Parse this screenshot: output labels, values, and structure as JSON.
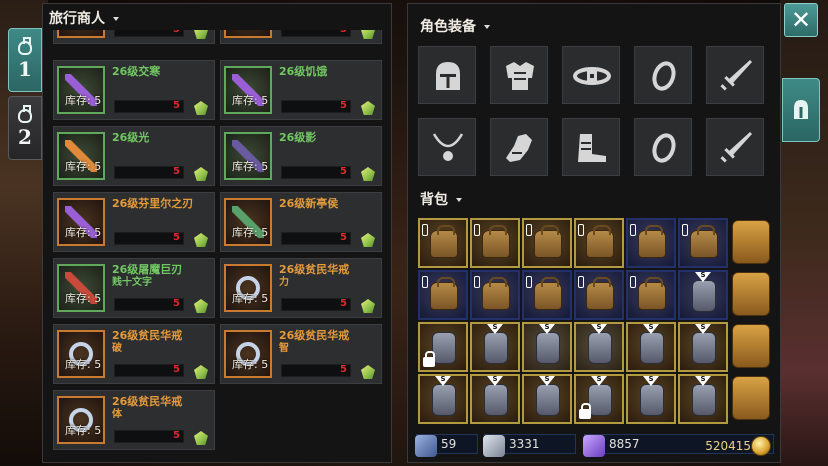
{
  "merchant": {
    "title": "旅行商人",
    "stock_prefix": "库存:",
    "items": [
      {
        "name": "",
        "stock": "5",
        "price": "5",
        "rarity": "orange",
        "partial": true
      },
      {
        "name": "",
        "stock": "5",
        "price": "5",
        "rarity": "orange",
        "partial": true
      },
      {
        "name": "26级交寒",
        "stock": "5",
        "price": "5",
        "rarity": "green",
        "icon": "purple-sword-icon"
      },
      {
        "name": "26级饥饿",
        "stock": "5",
        "price": "5",
        "rarity": "green",
        "icon": "purple-sword-icon"
      },
      {
        "name": "26级光",
        "stock": "5",
        "price": "5",
        "rarity": "green",
        "icon": "fire-dagger-icon"
      },
      {
        "name": "26级影",
        "stock": "5",
        "price": "5",
        "rarity": "green",
        "icon": "dark-mace-icon"
      },
      {
        "name": "26级芬里尔之刃",
        "stock": "5",
        "price": "5",
        "rarity": "orange",
        "icon": "purple-blade-icon"
      },
      {
        "name": "26级新亭侯",
        "stock": "5",
        "price": "5",
        "rarity": "orange",
        "icon": "green-blade-icon"
      },
      {
        "name": "26级屠魔巨刃",
        "subname": "贱十文字",
        "stock": "5",
        "price": "5",
        "rarity": "green",
        "icon": "red-greatsword-icon"
      },
      {
        "name": "26级贫民华戒",
        "subname": "力",
        "stock": "5",
        "price": "5",
        "rarity": "orange",
        "icon": "silver-ring-icon"
      },
      {
        "name": "26级贫民华戒",
        "subname": "破",
        "stock": "5",
        "price": "5",
        "rarity": "orange",
        "icon": "silver-ring-icon"
      },
      {
        "name": "26级贫民华戒",
        "subname": "智",
        "stock": "5",
        "price": "5",
        "rarity": "orange",
        "icon": "silver-ring-icon"
      },
      {
        "name": "26级贫民华戒",
        "subname": "体",
        "stock": "5",
        "price": "5",
        "rarity": "orange",
        "icon": "silver-ring-icon"
      }
    ]
  },
  "side_tabs": [
    {
      "label": "1",
      "active": true,
      "icon": "potion-icon"
    },
    {
      "label": "2",
      "active": false,
      "icon": "potion-icon"
    }
  ],
  "equipment": {
    "title": "角色装备",
    "slots": [
      {
        "name": "helmet-slot",
        "icon": "helmet-icon"
      },
      {
        "name": "chest-slot",
        "icon": "chest-armor-icon"
      },
      {
        "name": "belt-slot",
        "icon": "belt-icon"
      },
      {
        "name": "ring-slot-1",
        "icon": "ring-icon"
      },
      {
        "name": "weapon-slot-1",
        "icon": "sword-icon"
      },
      {
        "name": "necklace-slot",
        "icon": "necklace-icon"
      },
      {
        "name": "gloves-slot",
        "icon": "gloves-icon"
      },
      {
        "name": "boots-slot",
        "icon": "boots-icon"
      },
      {
        "name": "ring-slot-2",
        "icon": "ring-icon"
      },
      {
        "name": "weapon-slot-2",
        "icon": "sword-icon"
      }
    ]
  },
  "bag": {
    "title": "背包",
    "badge_letter": "S"
  },
  "currency": {
    "sword_count": "59",
    "silver_count": "3331",
    "crystal_count": "8857",
    "gold": "520415"
  },
  "colors": {
    "green_rarity": "#72c763",
    "orange_rarity": "#e59a3c",
    "price_red": "#e0272c",
    "teal_accent": "#3f8a86"
  }
}
